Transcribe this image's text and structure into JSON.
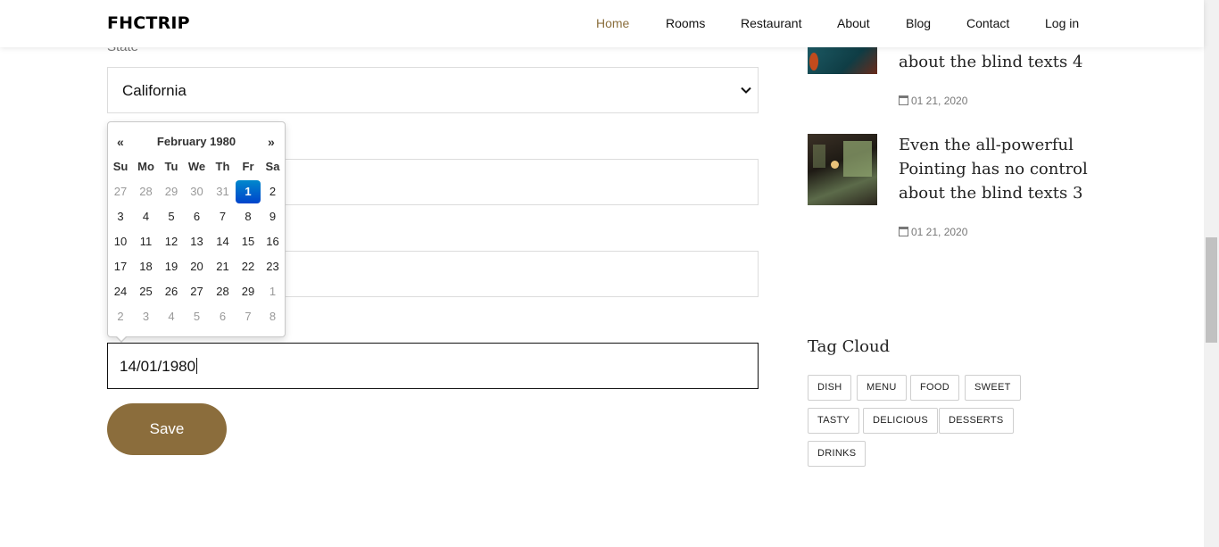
{
  "header": {
    "brand": "FHCTRIP",
    "nav": [
      "Home",
      "Rooms",
      "Restaurant",
      "About",
      "Blog",
      "Contact",
      "Log in"
    ],
    "active": "Home",
    "active_color": "#8b6f3e"
  },
  "form": {
    "state_label": "State",
    "state_value": "California",
    "date_value": "14/01/1980",
    "save_label": "Save",
    "save_color": "#8b6d3c"
  },
  "datepicker": {
    "prev": "«",
    "next": "»",
    "title": "February 1980",
    "dow": [
      "Su",
      "Mo",
      "Tu",
      "We",
      "Th",
      "Fr",
      "Sa"
    ],
    "weeks": [
      [
        "27",
        "28",
        "29",
        "30",
        "31",
        "1",
        "2"
      ],
      [
        "3",
        "4",
        "5",
        "6",
        "7",
        "8",
        "9"
      ],
      [
        "10",
        "11",
        "12",
        "13",
        "14",
        "15",
        "16"
      ],
      [
        "17",
        "18",
        "19",
        "20",
        "21",
        "22",
        "23"
      ],
      [
        "24",
        "25",
        "26",
        "27",
        "28",
        "29",
        "1"
      ],
      [
        "2",
        "3",
        "4",
        "5",
        "6",
        "7",
        "8"
      ]
    ],
    "selected_day": "1",
    "selected_color": "#0066cc"
  },
  "sidebar": {
    "posts": [
      {
        "title_lines": [
          "about the blind texts 4"
        ],
        "date": "01 21, 2020"
      },
      {
        "title_lines": [
          "Even the all-powerful",
          "Pointing has no control",
          "about the blind texts 3"
        ],
        "date": "01 21, 2020"
      }
    ],
    "tag_heading": "Tag Cloud",
    "tags": [
      "DISH",
      "MENU",
      "FOOD",
      "SWEET",
      "TASTY",
      "DELICIOUS",
      "DESSERTS",
      "DRINKS"
    ]
  }
}
